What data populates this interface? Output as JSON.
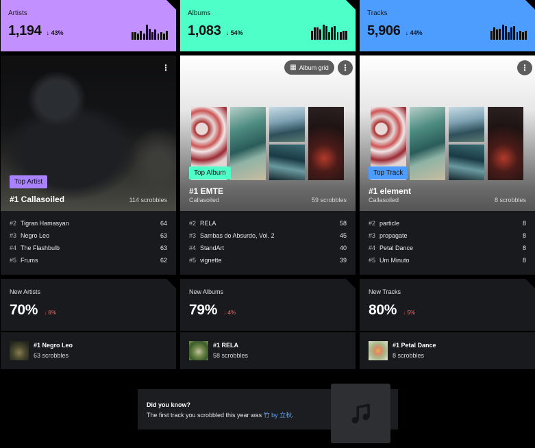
{
  "stats": [
    {
      "label": "Artists",
      "value": "1,194",
      "change": "43%",
      "color": "#c391ff",
      "spark": [
        12,
        12,
        10,
        14,
        10,
        24,
        18,
        12,
        16,
        10,
        12,
        10,
        14
      ]
    },
    {
      "label": "Albums",
      "value": "1,083",
      "change": "54%",
      "color": "#4fffc8",
      "spark": [
        14,
        20,
        20,
        16,
        24,
        22,
        12,
        20,
        22,
        12,
        12,
        14,
        14
      ]
    },
    {
      "label": "Tracks",
      "value": "5,906",
      "change": "44%",
      "color": "#4c9dff",
      "spark": [
        14,
        20,
        16,
        18,
        24,
        22,
        12,
        20,
        22,
        12,
        14,
        12,
        14
      ]
    }
  ],
  "features": [
    {
      "chip": "Top Artist",
      "chip_color": "#a982ff",
      "title": "#1 Callasoiled",
      "subtitle": "",
      "scrobbles": "114 scrobbles"
    },
    {
      "chip": "Top Album",
      "chip_color": "#4fffc8",
      "title": "#1 EMTE",
      "subtitle": "Callasoiled",
      "scrobbles": "59 scrobbles",
      "grid_button": "Album grid"
    },
    {
      "chip": "Top Track",
      "chip_color": "#4c9dff",
      "title": "#1 element",
      "subtitle": "Callasoiled",
      "scrobbles": "8 scrobbles"
    }
  ],
  "lists": [
    [
      {
        "rank": "#2",
        "name": "Tigran Hamasyan",
        "count": "64"
      },
      {
        "rank": "#3",
        "name": "Negro Leo",
        "count": "63"
      },
      {
        "rank": "#4",
        "name": "The Flashbulb",
        "count": "63"
      },
      {
        "rank": "#5",
        "name": "Frums",
        "count": "62"
      }
    ],
    [
      {
        "rank": "#2",
        "name": "RELA",
        "count": "58"
      },
      {
        "rank": "#3",
        "name": "Sambas do Absurdo, Vol. 2",
        "count": "45"
      },
      {
        "rank": "#4",
        "name": "StandArt",
        "count": "40"
      },
      {
        "rank": "#5",
        "name": "vignette",
        "count": "39"
      }
    ],
    [
      {
        "rank": "#2",
        "name": "particle",
        "count": "8"
      },
      {
        "rank": "#3",
        "name": "propagate",
        "count": "8"
      },
      {
        "rank": "#4",
        "name": "Petal Dance",
        "count": "8"
      },
      {
        "rank": "#5",
        "name": "Um Minuto",
        "count": "8"
      }
    ]
  ],
  "news": [
    {
      "label": "New Artists",
      "percent": "70%",
      "change": "6%",
      "top": "#1 Negro Leo",
      "scrobbles": "63 scrobbles"
    },
    {
      "label": "New Albums",
      "percent": "79%",
      "change": "4%",
      "top": "#1 RELA",
      "scrobbles": "58 scrobbles"
    },
    {
      "label": "New Tracks",
      "percent": "80%",
      "change": "5%",
      "top": "#1 Petal Dance",
      "scrobbles": "8 scrobbles"
    }
  ],
  "did_you_know": {
    "title": "Did you know?",
    "text": "The first track you scrobbled this year was",
    "link": "竹 by 立秋",
    "end": "."
  },
  "icons": {
    "more": "more-vertical-icon",
    "grid": "grid-icon",
    "arrow": "arrow-down-icon",
    "music": "music-note-icon"
  }
}
